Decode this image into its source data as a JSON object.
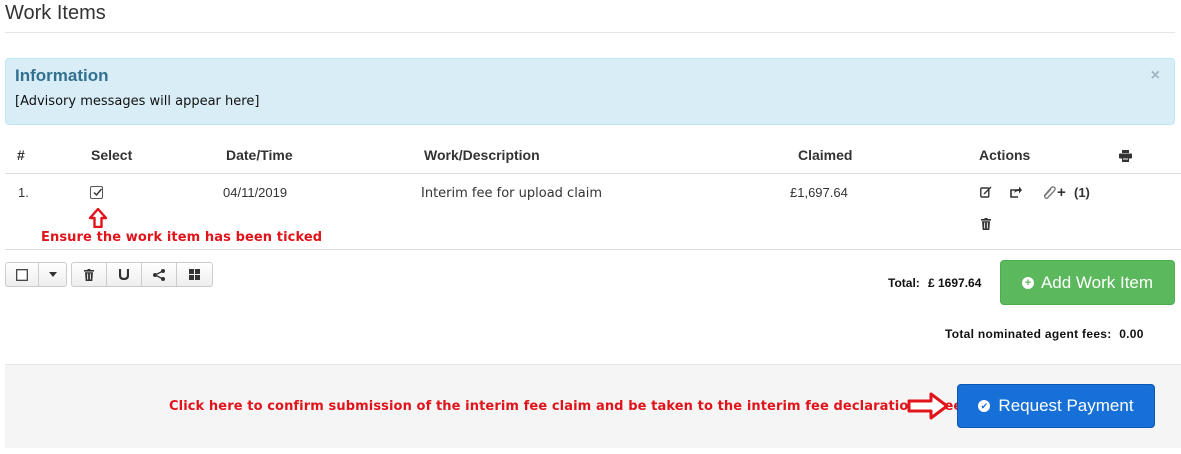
{
  "page": {
    "title": "Work Items"
  },
  "alert": {
    "heading": "Information",
    "message": "[Advisory messages will appear here]",
    "close_symbol": "×"
  },
  "table": {
    "headers": {
      "num": "#",
      "select": "Select",
      "datetime": "Date/Time",
      "description": "Work/Description",
      "claimed": "Claimed",
      "actions": "Actions"
    },
    "rows": [
      {
        "num": "1.",
        "selected": true,
        "datetime": "04/11/2019",
        "description": "Interim fee for upload claim",
        "claimed": "£1,697.64",
        "attachments": "(1)"
      }
    ]
  },
  "icons": {
    "print": "print-icon",
    "edit": "edit-icon",
    "share": "share-icon",
    "attach": "paperclip-icon",
    "add": "plus-icon",
    "delete": "trash-icon",
    "select_all": "checkbox-icon",
    "dropdown": "caret-down-icon",
    "magnet": "magnet-icon",
    "share_group": "share-nodes-icon",
    "grid": "grid-icon"
  },
  "annotations": {
    "tick_note": "Ensure the work item has been ticked",
    "submit_note": "Click here to confirm submission of the interim fee claim and be taken to the interim fee declaration screen"
  },
  "totals": {
    "label": "Total:",
    "value": "£ 1697.64",
    "nominated_label": "Total nominated agent fees:",
    "nominated_value": "0.00"
  },
  "buttons": {
    "add_work_item": "Add Work Item",
    "request_payment": "Request Payment"
  },
  "colors": {
    "alert_bg": "#d9edf7",
    "alert_heading": "#31708f",
    "success": "#5cb85c",
    "primary": "#1770d8",
    "annotation_red": "#e0141a"
  }
}
